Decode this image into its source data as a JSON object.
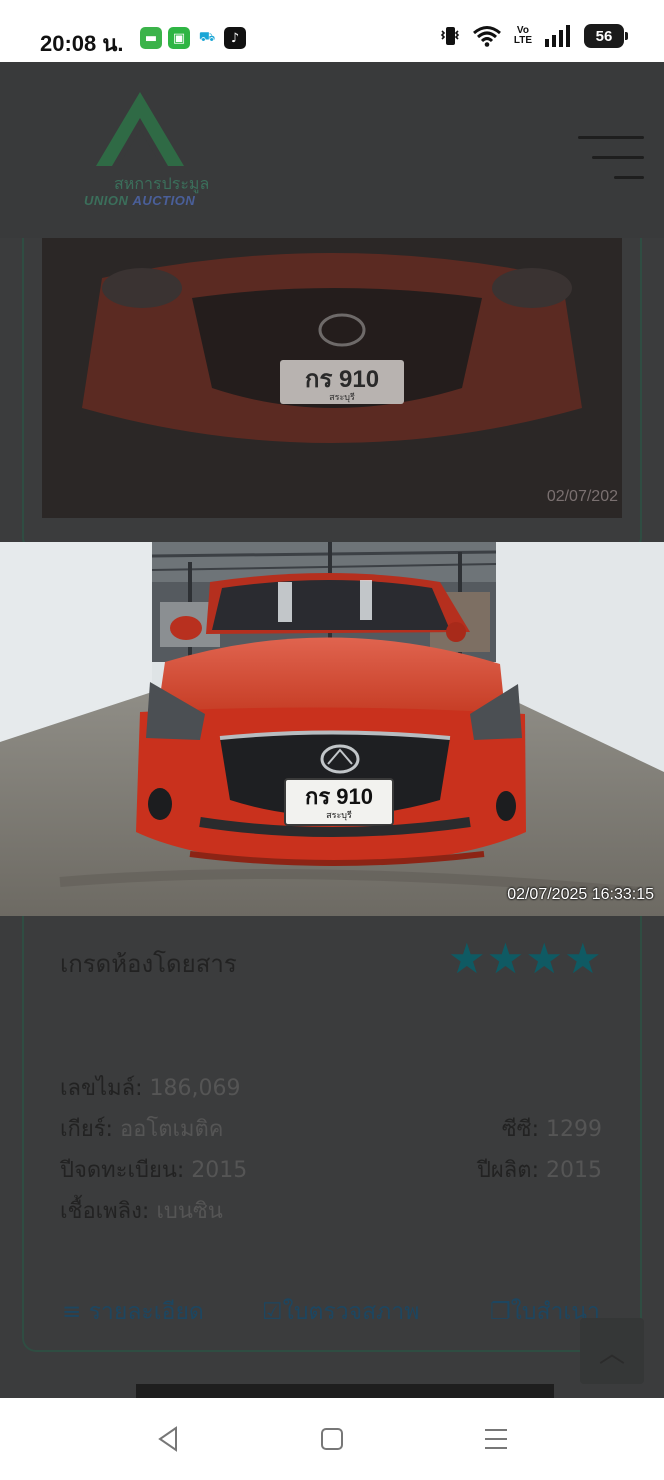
{
  "status_bar": {
    "time": "20:08 น.",
    "battery": "56",
    "volte_top": "Vo",
    "volte_bottom": "LTE"
  },
  "header": {
    "logo_thai": "สหการประมูล",
    "logo_en_1": "UNION ",
    "logo_en_2": "AUCTION"
  },
  "photo": {
    "timestamp": "02/07/2025 16:33:15",
    "plate_text": "กร 910",
    "plate_province": "สระบุรี"
  },
  "background_photo": {
    "timestamp": "02/07/202",
    "plate_text": "กร 910",
    "plate_province": "สระบุรี"
  },
  "card": {
    "grade_label": "เกรดห้องโดยสาร",
    "rating": 4,
    "mileage_label": "เลขไมล์:",
    "mileage_value": "186,069",
    "gear_label": "เกียร์:",
    "gear_value": "ออโตเมติค",
    "cc_label": "ซีซี:",
    "cc_value": "1299",
    "reg_year_label": "ปีจดทะเบียน:",
    "reg_year_value": "2015",
    "prod_year_label": "ปีผลิต:",
    "prod_year_value": "2015",
    "fuel_label": "เชื้อเพลิง:",
    "fuel_value": "เบนซิน",
    "details_link": "≡ รายละเอียด",
    "inspection_link": "ใบตรวจสภาพ",
    "copy_link": "ใบสำเนา"
  },
  "colors": {
    "overlay_bg": "#3b3c3d",
    "star": "#0f5a63",
    "link": "#1d4660",
    "car_red": "#c9311d"
  }
}
